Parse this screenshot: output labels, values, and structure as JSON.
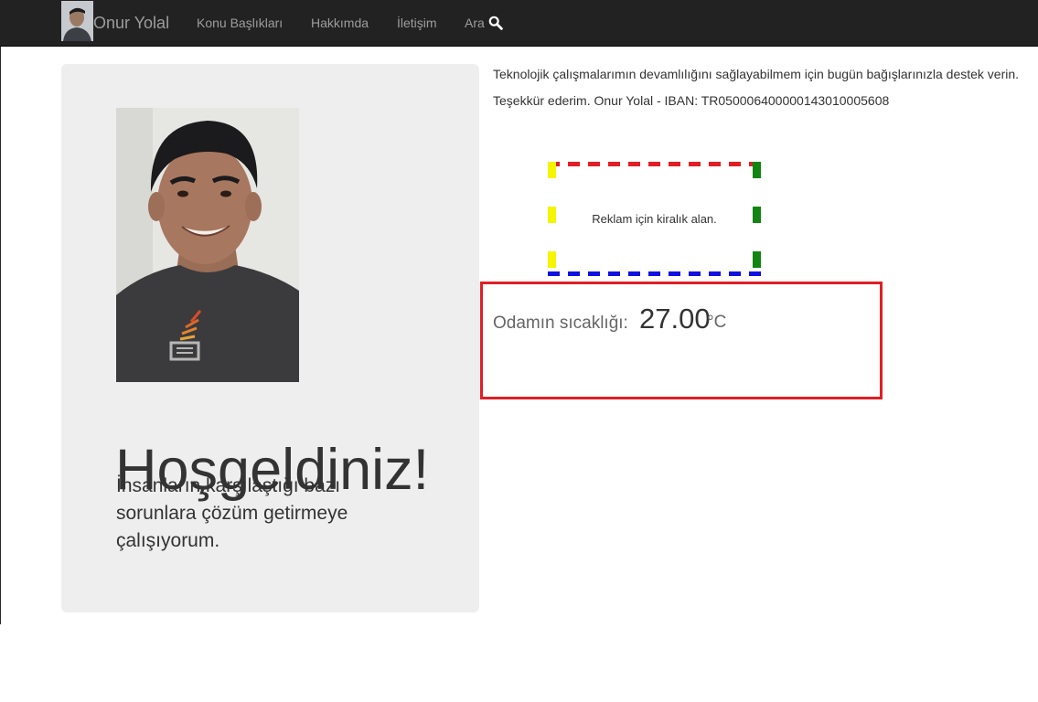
{
  "nav": {
    "brand": "Onur Yolal",
    "items": [
      {
        "label": "Konu Başlıkları"
      },
      {
        "label": "Hakkımda"
      },
      {
        "label": "İletişim"
      },
      {
        "label": "Ara"
      }
    ],
    "search_icon": "search-icon",
    "background": "#222222",
    "text_color": "#9d9d9d"
  },
  "hero": {
    "title": "Hoşgeldiniz!",
    "text": "İnsanların karşılaştığı bazı sorunlara çözüm getirmeye çalışıyorum."
  },
  "donation": {
    "line1": "Teknolojik çalışmalarımın devamlılığını sağlayabilmem için bugün bağışlarınızla destek verin.",
    "line2": "Teşekkür ederim. Onur Yolal - IBAN: TR050006400000143010005608"
  },
  "ad": {
    "text": "Reklam için kiralık alan.",
    "border_colors": {
      "top": "#e21e25",
      "right": "#118511",
      "bottom": "#1010e0",
      "left": "#f5f500"
    }
  },
  "temperature": {
    "label": "Odamın sıcaklığı:",
    "value": "27.00",
    "unit": "°C",
    "border_color": "#e21e25"
  }
}
